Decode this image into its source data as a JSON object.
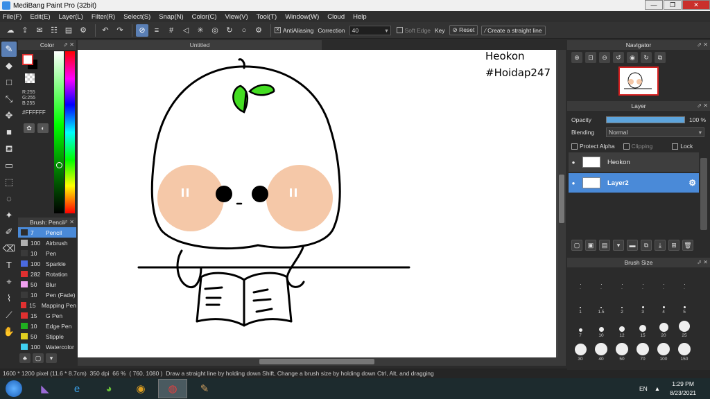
{
  "window": {
    "title": "MediBang Paint Pro (32bit)",
    "minimize": "—",
    "restore": "❐",
    "close": "✕"
  },
  "menu": [
    "File(F)",
    "Edit(E)",
    "Layer(L)",
    "Filter(R)",
    "Select(S)",
    "Snap(N)",
    "Color(C)",
    "View(V)",
    "Tool(T)",
    "Window(W)",
    "Cloud",
    "Help"
  ],
  "toolbar": {
    "antialiasing_label": "AntiAliasing",
    "antialiasing_checked": true,
    "correction_label": "Correction",
    "correction_value": "40",
    "soft_edge_label": "Soft Edge",
    "key_label": "Key",
    "reset_label": "Reset",
    "straight_line_label": "Create a straight line"
  },
  "color_panel": {
    "title": "Color",
    "r": "R:255",
    "g": "G:255",
    "b": "B:255",
    "hex": "#FFFFFF",
    "fg_color": "#ffffff",
    "bg_color": "#000000"
  },
  "brush_panel": {
    "title": "Brush: Pencil",
    "items": [
      {
        "size": "7",
        "name": "Pencil",
        "color": "#2d2d2d",
        "selected": true
      },
      {
        "size": "100",
        "name": "Airbrush",
        "color": "#b0b0b0"
      },
      {
        "size": "10",
        "name": "Pen",
        "color": "#3a3a3a"
      },
      {
        "size": "100",
        "name": "Sparkle",
        "color": "#4a6ae0"
      },
      {
        "size": "282",
        "name": "Rotation",
        "color": "#e03030"
      },
      {
        "size": "50",
        "name": "Blur",
        "color": "#f0a0f0"
      },
      {
        "size": "10",
        "name": "Pen (Fade)",
        "color": "#3a3a3a"
      },
      {
        "size": "15",
        "name": "Mapping Pen",
        "color": "#e03030"
      },
      {
        "size": "15",
        "name": "G Pen",
        "color": "#e03030"
      },
      {
        "size": "10",
        "name": "Edge Pen",
        "color": "#20b020"
      },
      {
        "size": "50",
        "name": "Stipple",
        "color": "#e0d020"
      },
      {
        "size": "100",
        "name": "Watercolor",
        "color": "#40d0f0"
      }
    ]
  },
  "document": {
    "tab": "Untitled"
  },
  "canvas": {
    "text_line1": "Heokon",
    "text_line2": "#Hoidap247"
  },
  "status": {
    "size": "1600 * 1200 pixel",
    "physical": "(11.6 * 8.7cm)",
    "dpi": "350 dpi",
    "zoom": "66 %",
    "coords": "( 760, 1080 )",
    "hint": "Draw a straight line by holding down Shift, Change a brush size by holding down Ctrl, Alt, and dragging"
  },
  "navigator": {
    "title": "Navigator"
  },
  "layer_panel": {
    "title": "Layer",
    "opacity_label": "Opacity",
    "opacity_value": "100 %",
    "opacity_fraction": 1.0,
    "blending_label": "Blending",
    "blending_value": "Normal",
    "protect_alpha": "Protect Alpha",
    "clipping": "Clipping",
    "lock": "Lock",
    "layers": [
      {
        "name": "Heokon",
        "selected": false
      },
      {
        "name": "Layer2",
        "selected": true
      }
    ]
  },
  "brush_size": {
    "title": "Brush Size",
    "sizes": [
      "·",
      "·",
      "·",
      "·",
      "·",
      "·",
      "1",
      "1.5",
      "2",
      "3",
      "4",
      "5",
      "7",
      "10",
      "12",
      "15",
      "20",
      "25",
      "30",
      "40",
      "50",
      "70",
      "100",
      "150"
    ]
  },
  "taskbar": {
    "lang": "EN",
    "time": "1:29 PM",
    "date": "8/23/2021"
  }
}
